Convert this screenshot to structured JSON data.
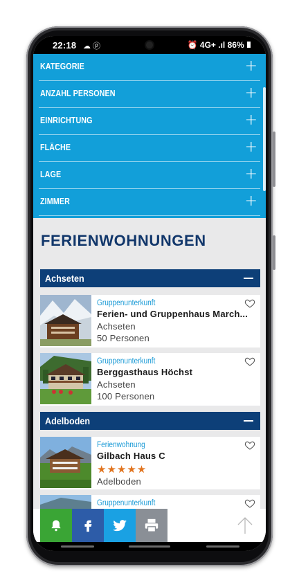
{
  "status_bar": {
    "time": "22:18",
    "left_icons": "☁ ⓟ",
    "right_icons": "⏰ 4G+ .ıl",
    "battery": "86%"
  },
  "filters": [
    {
      "label": "KATEGORIE"
    },
    {
      "label": "ANZAHL PERSONEN"
    },
    {
      "label": "EINRICHTUNG"
    },
    {
      "label": "FLÄCHE"
    },
    {
      "label": "LAGE"
    },
    {
      "label": "ZIMMER"
    }
  ],
  "filter_toggle_symbol": "+",
  "page_title": "FERIENWOHNUNGEN",
  "groups": [
    {
      "location": "Achseten",
      "listings": [
        {
          "category": "Gruppenunterkunft",
          "title": "Ferien- und Gruppenhaus March...",
          "place": "Achseten",
          "capacity": "50 Personen"
        },
        {
          "category": "Gruppenunterkunft",
          "title": "Berggasthaus Höchst",
          "place": "Achseten",
          "capacity": "100 Personen"
        }
      ]
    },
    {
      "location": "Adelboden",
      "listings": [
        {
          "category": "Ferienwohnung",
          "title": "Gilbach Haus C",
          "stars": "★★★★★",
          "rating": 5,
          "place": "Adelboden"
        },
        {
          "category": "Gruppenunterkunft"
        }
      ]
    }
  ],
  "share_buttons": [
    {
      "name": "bell-icon",
      "color": "#3aa535"
    },
    {
      "name": "facebook-icon",
      "color": "#2d5ca8"
    },
    {
      "name": "twitter-icon",
      "color": "#1aa1e3"
    },
    {
      "name": "print-icon",
      "color": "#8a8f96"
    }
  ],
  "colors": {
    "filter_panel": "#129fd9",
    "title": "#12376b",
    "location_header": "#0d3f78",
    "category_text": "#1a9ad6",
    "stars": "#e1731d"
  }
}
